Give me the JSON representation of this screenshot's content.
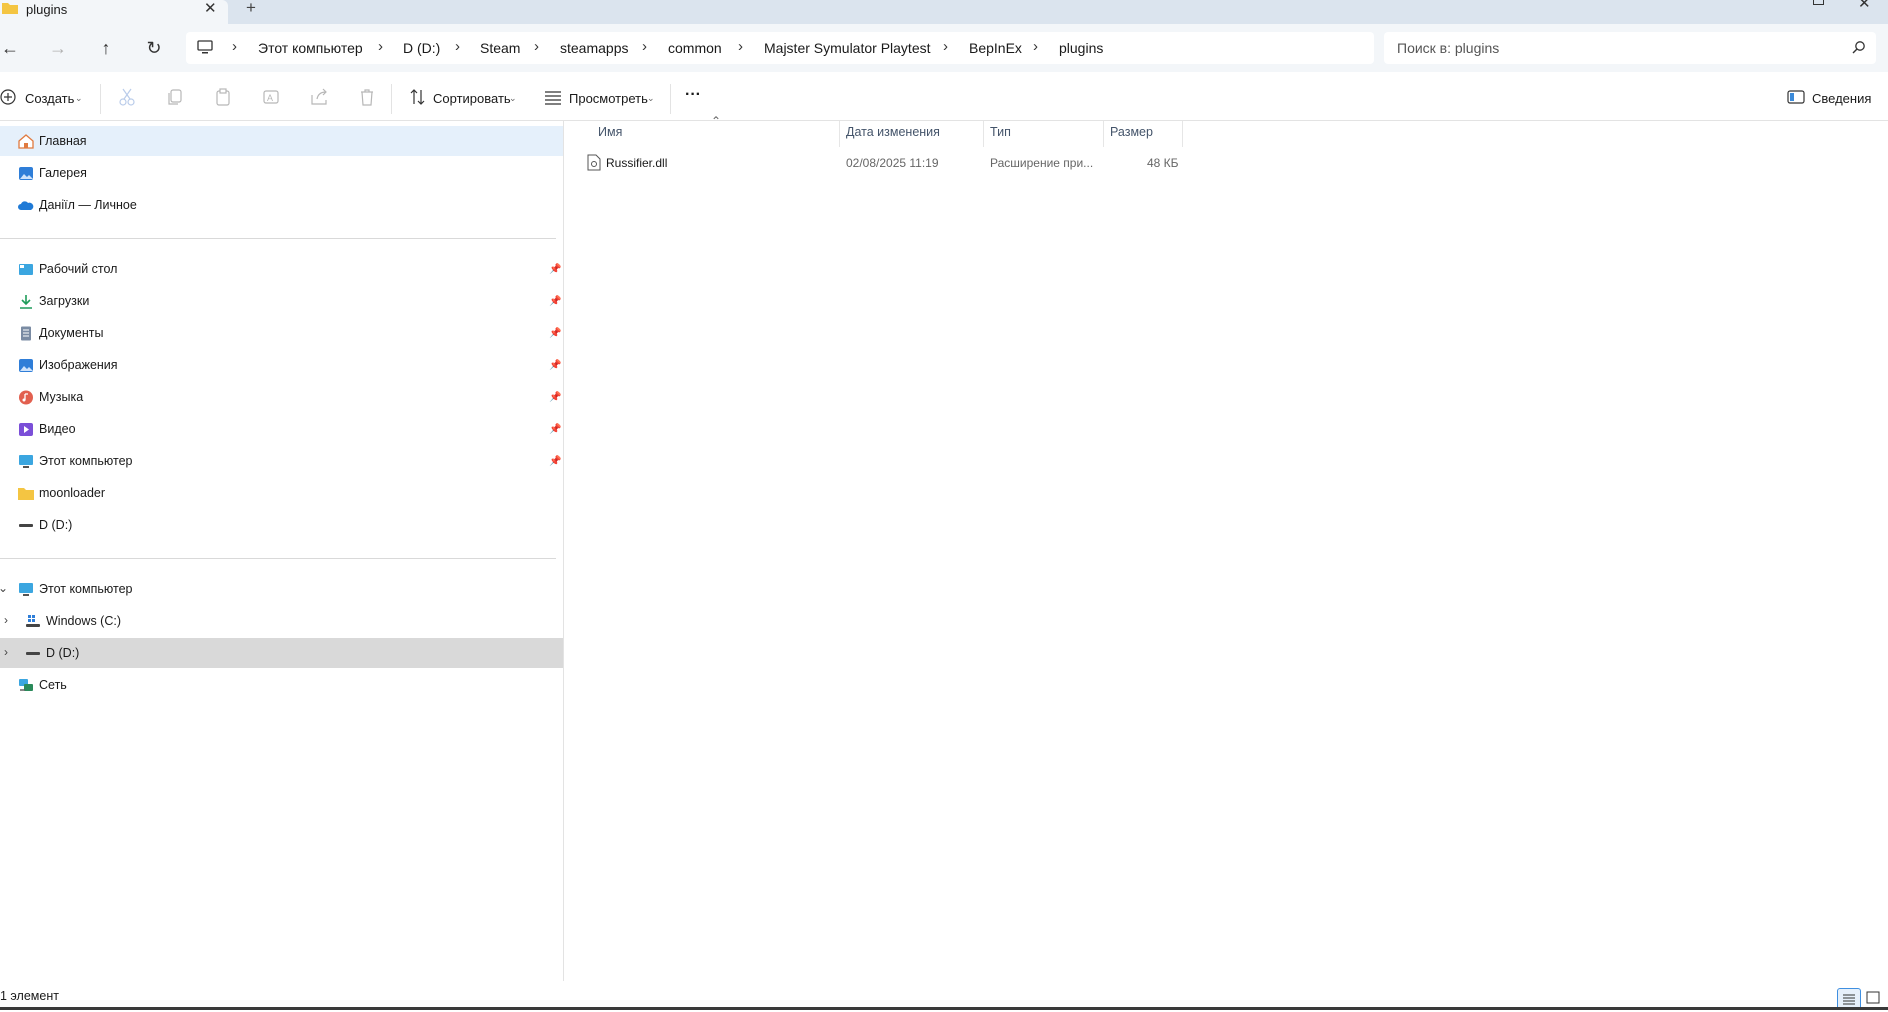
{
  "window": {
    "tab_title": "plugins",
    "new_tab": "+"
  },
  "address": {
    "breadcrumbs": [
      "Этот компьютер",
      "D (D:)",
      "Steam",
      "steamapps",
      "common",
      "Majster Symulator Playtest",
      "BepInEx",
      "plugins"
    ],
    "search_placeholder": "Поиск в: plugins"
  },
  "toolbar": {
    "create_label": "Создать",
    "sort_label": "Сортировать",
    "view_label": "Просмотреть",
    "more_label": "···",
    "details_label": "Сведения"
  },
  "sidebar": {
    "quick": [
      {
        "label": "Главная",
        "icon": "home-icon"
      },
      {
        "label": "Галерея",
        "icon": "gallery-icon"
      },
      {
        "label": "Даніїл — Личное",
        "icon": "onedrive-cloud-icon"
      }
    ],
    "pinned": [
      {
        "label": "Рабочий стол",
        "icon": "desktop-icon"
      },
      {
        "label": "Загрузки",
        "icon": "download-icon"
      },
      {
        "label": "Документы",
        "icon": "documents-icon"
      },
      {
        "label": "Изображения",
        "icon": "pictures-icon"
      },
      {
        "label": "Музыка",
        "icon": "music-icon"
      },
      {
        "label": "Видео",
        "icon": "video-icon"
      },
      {
        "label": "Этот компьютер",
        "icon": "computer-icon"
      },
      {
        "label": "moonloader",
        "icon": "folder-icon"
      },
      {
        "label": "D (D:)",
        "icon": "drive-icon"
      }
    ],
    "tree": [
      {
        "label": "Этот компьютер",
        "icon": "computer-icon"
      },
      {
        "label": "Windows (C:)",
        "icon": "windows-drive-icon"
      },
      {
        "label": "D (D:)",
        "icon": "drive-icon"
      },
      {
        "label": "Сеть",
        "icon": "network-icon"
      }
    ]
  },
  "columns": {
    "name": "Имя",
    "date": "Дата изменения",
    "type": "Тип",
    "size": "Размер"
  },
  "files": [
    {
      "name": "Russifier.dll",
      "date": "02/08/2025 11:19",
      "type": "Расширение при...",
      "size": "48 КБ"
    }
  ],
  "status": {
    "count": "1 элемент"
  },
  "colors": {
    "selected_home": "#e5f0fb",
    "selected_drive": "#d9d9d9",
    "accent": "#0067c0"
  }
}
